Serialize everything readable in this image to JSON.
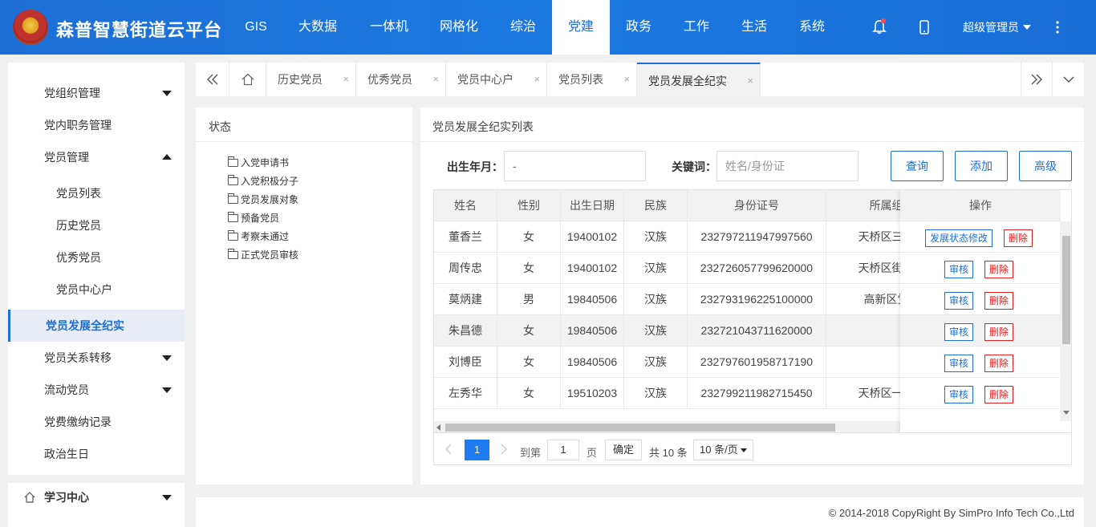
{
  "brand": {
    "title": "森普智慧街道云平台"
  },
  "nav": {
    "items": [
      "GIS",
      "大数据",
      "一体机",
      "网格化",
      "综治",
      "党建",
      "政务",
      "工作",
      "生活",
      "系统"
    ],
    "active": "党建"
  },
  "user": {
    "name": "超级管理员"
  },
  "sidebar": {
    "items": [
      {
        "label": "党组织管理",
        "caret": "down"
      },
      {
        "label": "党内职务管理"
      },
      {
        "label": "党员管理",
        "caret": "up"
      },
      {
        "label": "党员列表",
        "sub": true
      },
      {
        "label": "历史党员",
        "sub": true
      },
      {
        "label": "优秀党员",
        "sub": true
      },
      {
        "label": "党员中心户",
        "sub": true
      },
      {
        "label": "党员发展全纪实",
        "active": true
      },
      {
        "label": "党员关系转移",
        "caret": "down"
      },
      {
        "label": "流动党员",
        "caret": "down"
      },
      {
        "label": "党费缴纳记录"
      },
      {
        "label": "政治生日"
      }
    ],
    "bottom": {
      "label": "学习中心"
    }
  },
  "tabs": [
    "历史党员",
    "优秀党员",
    "党员中心户",
    "党员列表",
    "党员发展全纪实"
  ],
  "tab_close": "×",
  "left_panel": {
    "title": "状态",
    "tree": [
      "入党申请书",
      "入党积极分子",
      "党员发展对象",
      "预备党员",
      "考察未通过",
      "正式党员审核"
    ]
  },
  "right_panel": {
    "title": "党员发展全纪实列表"
  },
  "search": {
    "birth_label": "出生年月：",
    "birth_value": "-",
    "keyword_label": "关键词：",
    "keyword_placeholder": "姓名/身份证",
    "query": "查询",
    "add": "添加",
    "advanced": "高级"
  },
  "table": {
    "headers": [
      "姓名",
      "性别",
      "出生日期",
      "民族",
      "身份证号",
      "所属组",
      "操作"
    ],
    "rows": [
      [
        "董香兰",
        "女",
        "19400102",
        "汉族",
        "232797211947997560",
        "天桥区三号"
      ],
      [
        "周传忠",
        "女",
        "19400102",
        "汉族",
        "232726057799620000",
        "天桥区街道"
      ],
      [
        "莫炳建",
        "男",
        "19840506",
        "汉族",
        "232793196225100000",
        "高新区党"
      ],
      [
        "朱昌德",
        "女",
        "19840506",
        "汉族",
        "232721043711620000",
        ""
      ],
      [
        "刘博臣",
        "女",
        "19840506",
        "汉族",
        "232797601958717190",
        ""
      ],
      [
        "左秀华",
        "女",
        "19510203",
        "汉族",
        "232799211982715450",
        "天桥区一号"
      ]
    ],
    "op_first": "发展状态修改",
    "op_review": "审核",
    "op_delete": "删除"
  },
  "pager": {
    "current": "1",
    "goto_label": "到第",
    "goto_value": "1",
    "page_unit": "页",
    "confirm": "确定",
    "total": "共 10 条",
    "size": "10 条/页"
  },
  "footer": {
    "copyright": "© 2014-2018 CopyRight By SimPro Info Tech Co.,Ltd"
  }
}
